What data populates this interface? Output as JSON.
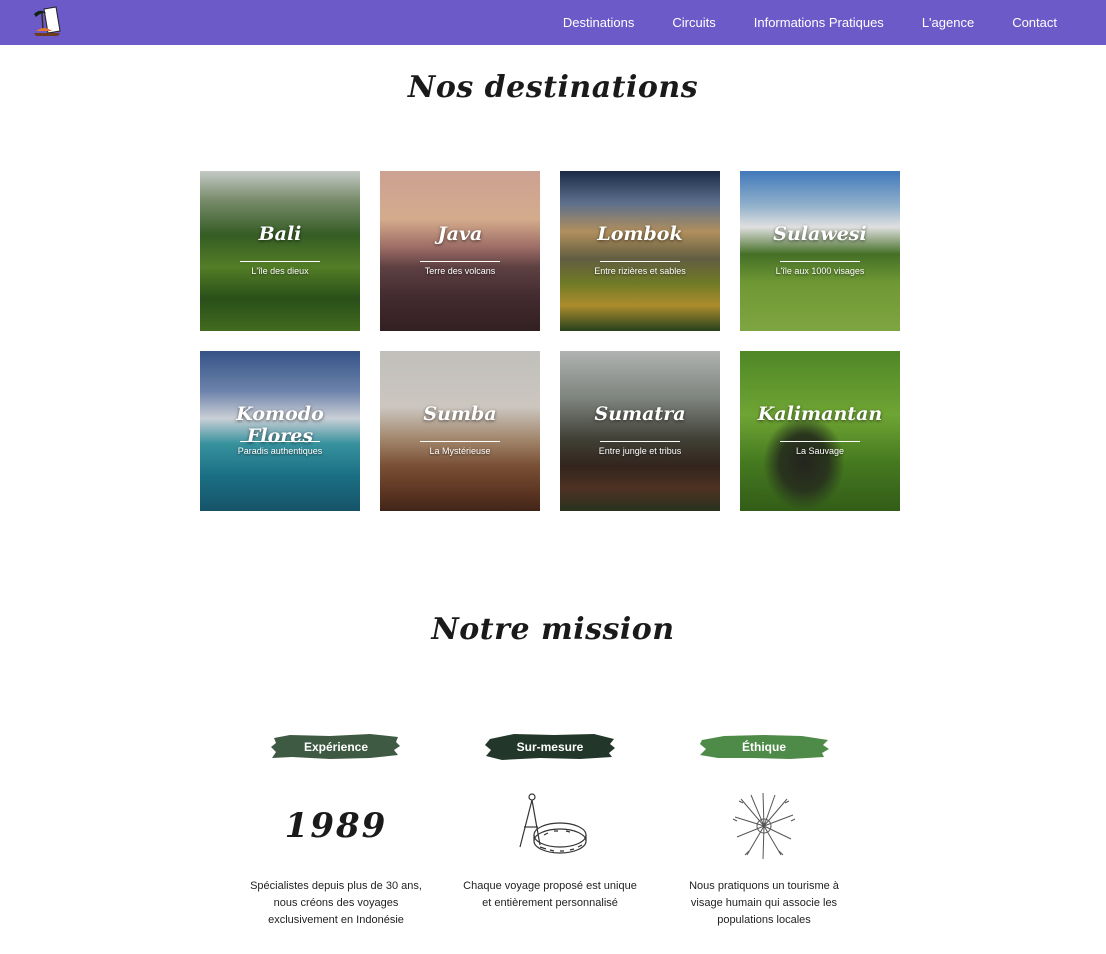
{
  "nav": {
    "links": [
      "Destinations",
      "Circuits",
      "Informations Pratiques",
      "L'agence",
      "Contact"
    ]
  },
  "destinations": {
    "title": "Nos destinations",
    "cards": [
      {
        "name": "Bali",
        "subtitle": "L'île des dieux"
      },
      {
        "name": "Java",
        "subtitle": "Terre des volcans"
      },
      {
        "name": "Lombok",
        "subtitle": "Entre rizières et sables"
      },
      {
        "name": "Sulawesi",
        "subtitle": "L'île aux 1000 visages"
      },
      {
        "name": "Komodo Flores",
        "subtitle": "Paradis authentiques"
      },
      {
        "name": "Sumba",
        "subtitle": "La Mystérieuse"
      },
      {
        "name": "Sumatra",
        "subtitle": "Entre jungle et tribus"
      },
      {
        "name": "Kalimantan",
        "subtitle": "La Sauvage"
      }
    ]
  },
  "mission": {
    "title": "Notre mission",
    "columns": [
      {
        "label": "Expérience",
        "year": "1989",
        "text": "Spécialistes depuis plus de 30 ans, nous créons des voyages exclusivement en Indonésie",
        "color": "#3f5a42"
      },
      {
        "label": "Sur-mesure",
        "text": "Chaque voyage proposé est unique et entièrement personnalisé",
        "color": "#22372a"
      },
      {
        "label": "Éthique",
        "text": "Nous pratiquons un tourisme à visage humain qui associe les populations locales",
        "color": "#4e8a48"
      }
    ]
  },
  "colors": {
    "navbar": "#6b5ac8"
  }
}
